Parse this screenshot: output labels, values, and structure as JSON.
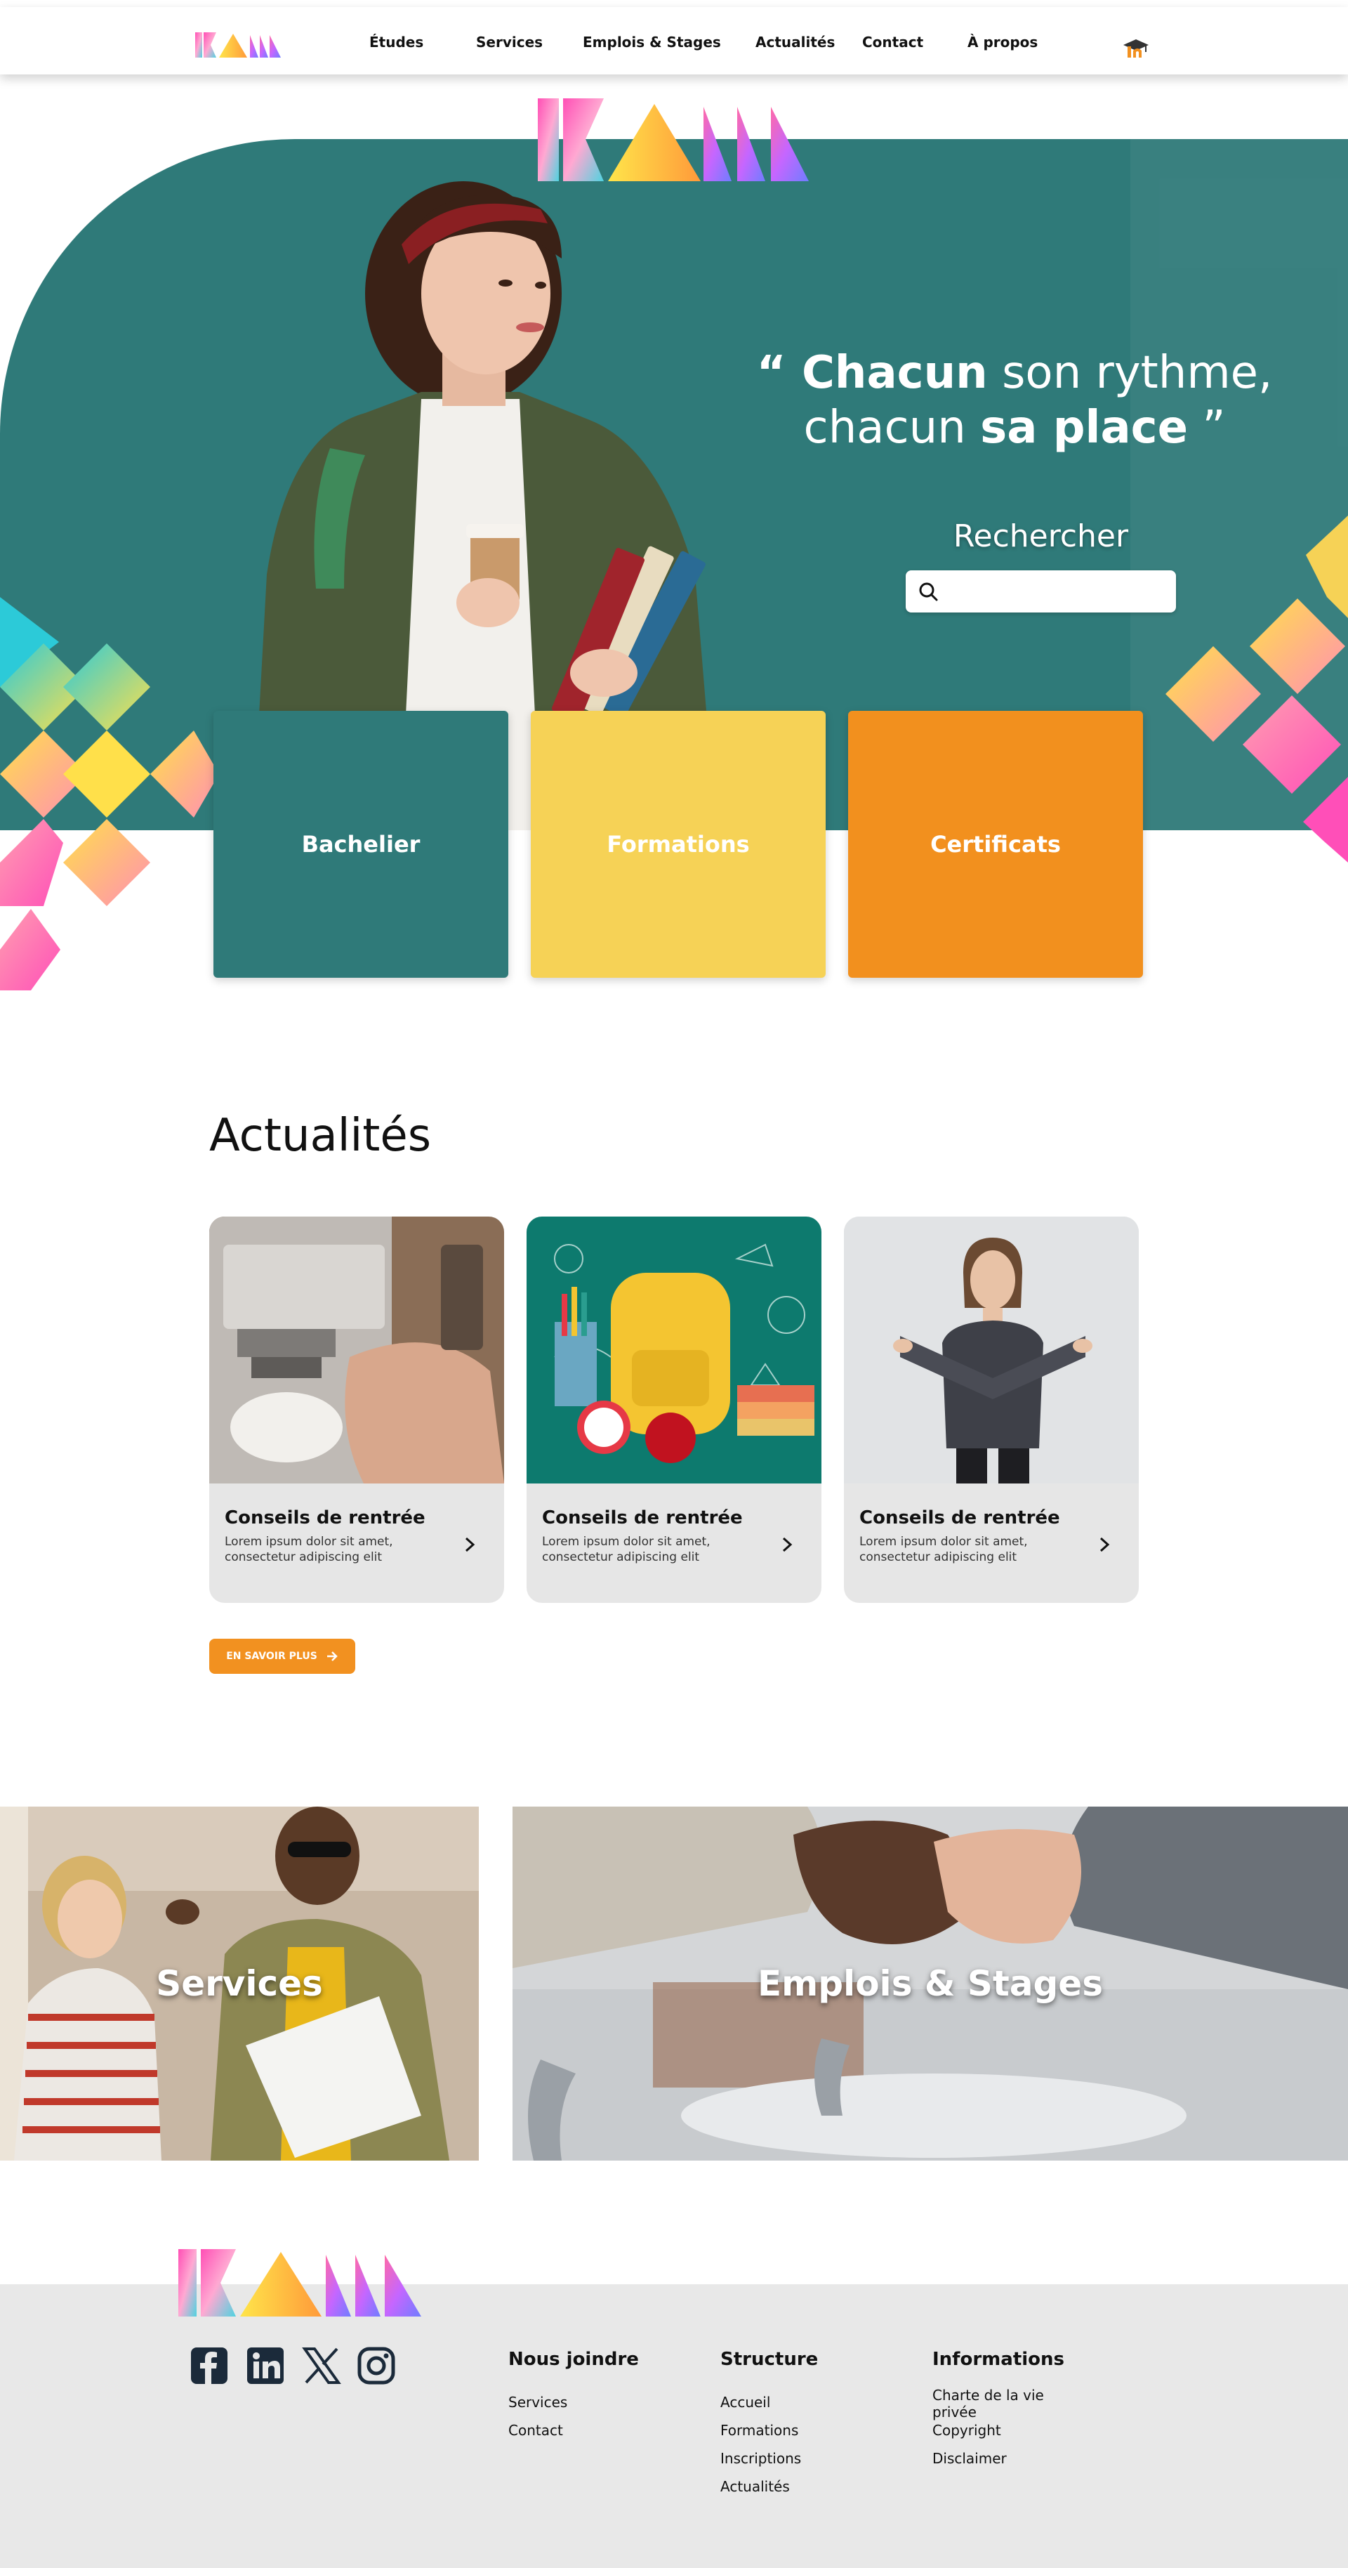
{
  "nav": {
    "items": [
      "Études",
      "Services",
      "Emplois & Stages",
      "Actualités",
      "Contact",
      "À propos"
    ]
  },
  "hero": {
    "quote_part1": "“ Chacun",
    "quote_part2": " son rythme,",
    "quote_part3": "chacun ",
    "quote_part4": "sa place",
    "quote_part5": " ”",
    "search_label": "Rechercher",
    "search_placeholder": ""
  },
  "categories": [
    {
      "label": "Bachelier",
      "color": "#2f7a79"
    },
    {
      "label": "Formations",
      "color": "#f6d256"
    },
    {
      "label": "Certificats",
      "color": "#f2901e"
    }
  ],
  "news": {
    "title": "Actualités",
    "cards": [
      {
        "title": "Conseils de rentrée",
        "excerpt": "Lorem ipsum dolor sit amet, consectetur adipiscing elit"
      },
      {
        "title": "Conseils de rentrée",
        "excerpt": "Lorem ipsum dolor sit amet, consectetur adipiscing elit"
      },
      {
        "title": "Conseils de rentrée",
        "excerpt": "Lorem ipsum dolor sit amet, consectetur adipiscing elit"
      }
    ],
    "more_label": "EN SAVOIR PLUS"
  },
  "promos": [
    {
      "label": "Services"
    },
    {
      "label": "Emplois & Stages"
    }
  ],
  "footer": {
    "social": [
      "facebook-icon",
      "linkedin-icon",
      "x-icon",
      "instagram-icon"
    ],
    "columns": [
      {
        "title": "Nous joindre",
        "links": [
          "Services",
          "Contact"
        ]
      },
      {
        "title": "Structure",
        "links": [
          "Accueil",
          "Formations",
          "Inscriptions",
          "Actualités"
        ]
      },
      {
        "title": "Informations",
        "links": [
          "Charte de la vie privée",
          "Copyright",
          "Disclaimer"
        ]
      }
    ]
  },
  "colors": {
    "teal": "#2f7a79",
    "yellow": "#f6d256",
    "orange": "#f2901e",
    "pink": "#ff5fb8"
  }
}
